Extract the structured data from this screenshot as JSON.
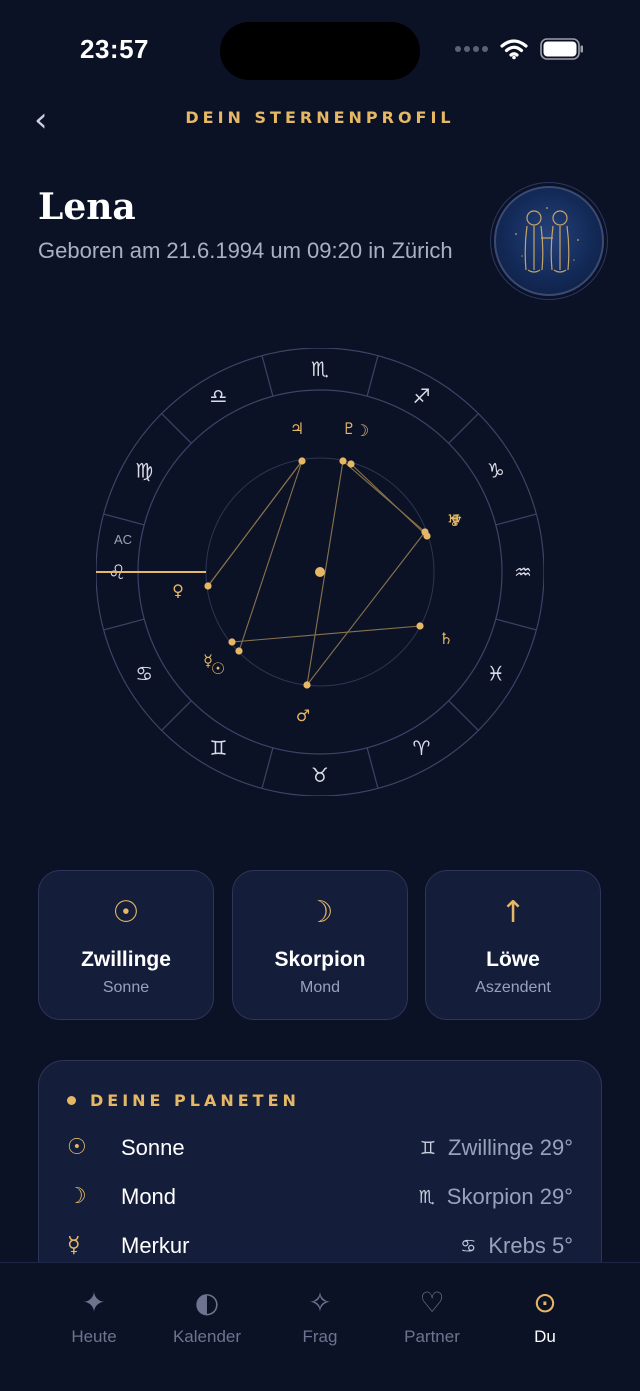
{
  "status": {
    "time": "23:57"
  },
  "header": {
    "back_icon": "‹",
    "title": "DEIN STERNENPROFIL"
  },
  "profile": {
    "name": "Lena",
    "birth_info": "Geboren am 21.6.1994 um 09:20 in Zürich",
    "avatar_icon": "gemini-twins-icon"
  },
  "chart": {
    "ac_label": "AC",
    "signs": [
      "♏",
      "♐",
      "♑",
      "♒",
      "♓",
      "♈",
      "♉",
      "♊",
      "♋",
      "♌",
      "♍",
      "♎"
    ],
    "planets": [
      "♃",
      "♇",
      "☽",
      "♅",
      "♆",
      "♄",
      "♂",
      "☿",
      "☉",
      "♀"
    ]
  },
  "cards": [
    {
      "icon": "☉",
      "sign": "Zwillinge",
      "label": "Sonne"
    },
    {
      "icon": "☽",
      "sign": "Skorpion",
      "label": "Mond"
    },
    {
      "icon": "↑",
      "sign": "Löwe",
      "label": "Aszendent"
    }
  ],
  "planets_panel": {
    "title": "DEINE PLANETEN",
    "rows": [
      {
        "icon": "☉",
        "name": "Sonne",
        "sign_icon": "♊",
        "value": "Zwillinge 29°"
      },
      {
        "icon": "☽",
        "name": "Mond",
        "sign_icon": "♏",
        "value": "Skorpion 29°"
      },
      {
        "icon": "☿",
        "name": "Merkur",
        "sign_icon": "♋",
        "value": "Krebs 5°"
      }
    ]
  },
  "nav": [
    {
      "icon": "✦",
      "label": "Heute"
    },
    {
      "icon": "◐",
      "label": "Kalender"
    },
    {
      "icon": "✧",
      "label": "Frag"
    },
    {
      "icon": "♡",
      "label": "Partner"
    },
    {
      "icon": "⊙",
      "label": "Du"
    }
  ],
  "colors": {
    "background": "#0c1226",
    "accent": "#e6b866",
    "card": "#141d3a"
  }
}
